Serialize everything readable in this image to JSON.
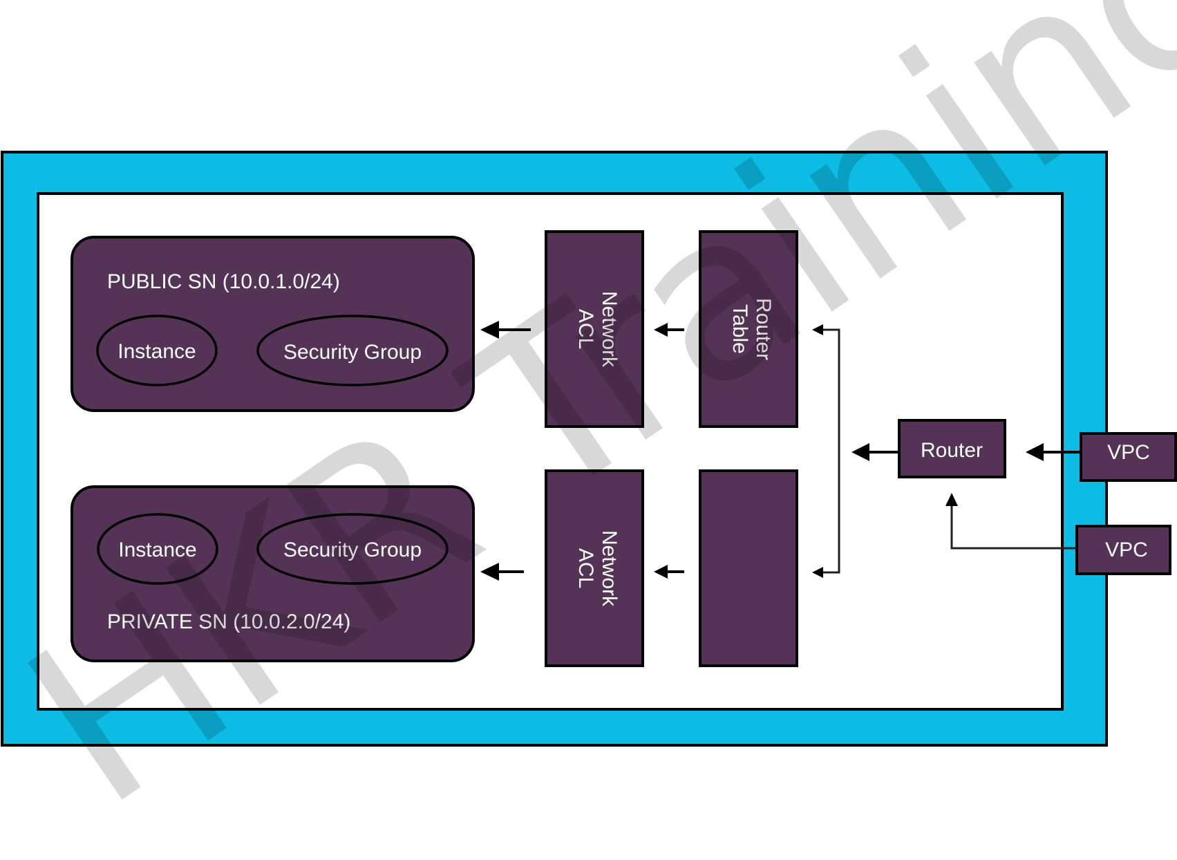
{
  "colors": {
    "vpc_frame": "#0cbce4",
    "component_fill": "#553357",
    "stroke": "#000000",
    "watermark": "#d9d9d9"
  },
  "subnets": {
    "public": {
      "label": "PUBLIC SN (10.0.1.0/24)",
      "instance_label": "Instance",
      "security_group_label": "Security Group"
    },
    "private": {
      "label": "PRIVATE SN (10.0.2.0/24)",
      "instance_label": "Instance",
      "security_group_label": "Security Group"
    }
  },
  "network_acls": [
    {
      "line1": "Network",
      "line2": "ACL"
    },
    {
      "line1": "Network",
      "line2": "ACL"
    }
  ],
  "route_tables": [
    {
      "line1": "Router",
      "line2": "Table"
    },
    {
      "line1": "",
      "line2": ""
    }
  ],
  "router": {
    "label": "Router"
  },
  "vpc_endpoints": [
    {
      "label": "VPC"
    },
    {
      "label": "VPC"
    }
  ],
  "watermark": {
    "text": "HKR Trainings"
  }
}
